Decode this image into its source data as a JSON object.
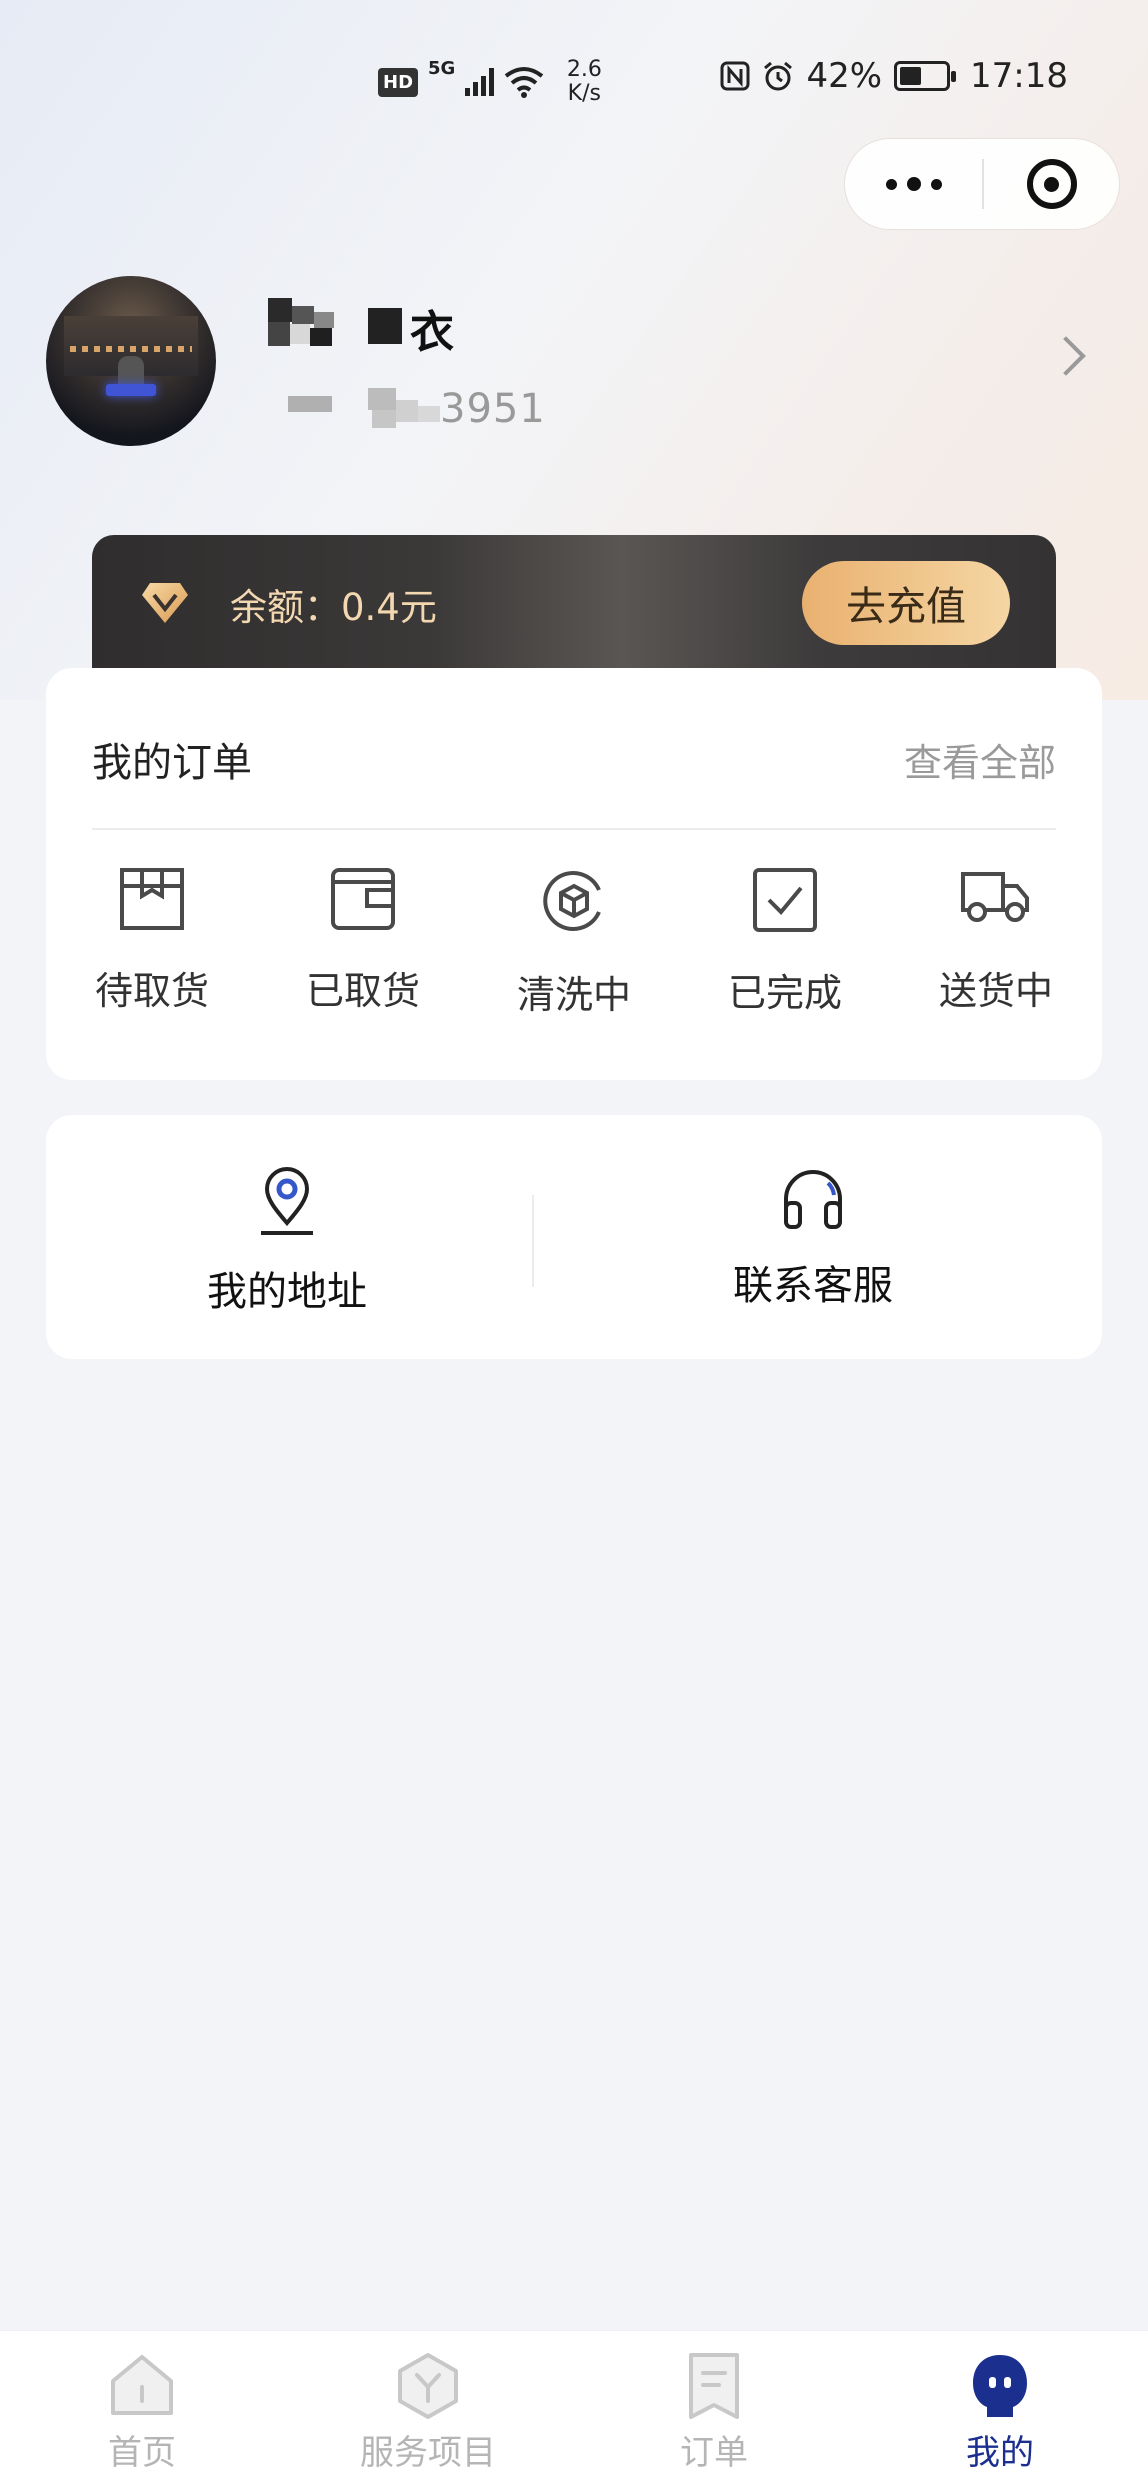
{
  "status_bar": {
    "hd": "HD",
    "net_type": "5G",
    "net_speed_value": "2.6",
    "net_speed_unit": "K/s",
    "nfc": "N",
    "battery": "42%",
    "time": "17:18"
  },
  "profile": {
    "name": "衣",
    "phone": "3951"
  },
  "balance": {
    "text": "余额：0.4元",
    "recharge_label": "去充值"
  },
  "orders": {
    "title": "我的订单",
    "view_all": "查看全部",
    "items": [
      {
        "label": "待取货",
        "icon": "package-icon"
      },
      {
        "label": "已取货",
        "icon": "wallet-icon"
      },
      {
        "label": "清洗中",
        "icon": "washing-icon"
      },
      {
        "label": "已完成",
        "icon": "checkbox-icon"
      },
      {
        "label": "送货中",
        "icon": "truck-icon"
      }
    ]
  },
  "services": [
    {
      "label": "我的地址",
      "icon": "location-pin-icon"
    },
    {
      "label": "联系客服",
      "icon": "headset-icon"
    }
  ],
  "tab_bar": {
    "active": "我的",
    "tabs": [
      {
        "label": "首页",
        "icon": "home-icon"
      },
      {
        "label": "服务项目",
        "icon": "service-icon"
      },
      {
        "label": "订单",
        "icon": "order-icon"
      },
      {
        "label": "我的",
        "icon": "profile-icon"
      }
    ]
  },
  "colors": {
    "accent": "#1b2f8f",
    "balance_text": "#f3d7b0",
    "recharge_gradient_start": "#e9b170",
    "recharge_gradient_end": "#f5d6a3"
  }
}
